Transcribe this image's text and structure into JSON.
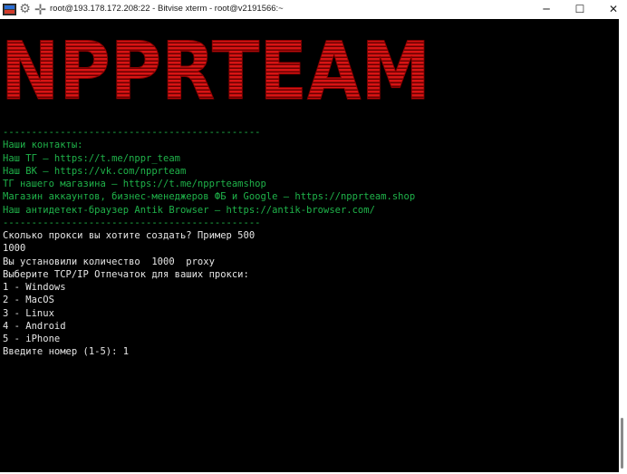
{
  "window": {
    "title": "root@193.178.172.208:22 - Bitvise xterm - root@v2191566:~",
    "app_icon": "terminal-app-icon",
    "gear_icon": "gear-icon",
    "new_icon": "plus-icon",
    "minimize": "─",
    "maximize": "☐",
    "close": "✕"
  },
  "banner": {
    "text": "NPPRTEAM",
    "color": "#d01010"
  },
  "terminal": {
    "lines": [
      {
        "text": "---------------------------------------------",
        "color": "green"
      },
      {
        "text": "Наши контакты:",
        "color": "green"
      },
      {
        "text": "Наш ТГ — https://t.me/nppr_team",
        "color": "green"
      },
      {
        "text": "Наш ВК — https://vk.com/npprteam",
        "color": "green"
      },
      {
        "text": "ТГ нашего магазина — https://t.me/npprteamshop",
        "color": "green"
      },
      {
        "text": "Магазин аккаунтов, бизнес-менеджеров ФБ и Google — https://npprteam.shop",
        "color": "green"
      },
      {
        "text": "Наш антидетект-браузер Antik Browser — https://antik-browser.com/",
        "color": "green"
      },
      {
        "text": "---------------------------------------------",
        "color": "green"
      },
      {
        "text": "Сколько прокси вы хотите создать? Пример 500",
        "color": "white"
      },
      {
        "text": "1000",
        "color": "white"
      },
      {
        "text": "Вы установили количество  1000  proxy",
        "color": "white"
      },
      {
        "text": "Выберите TCP/IP Отпечаток для ваших прокси:",
        "color": "white"
      },
      {
        "text": "1 - Windows",
        "color": "white"
      },
      {
        "text": "2 - MacOS",
        "color": "white"
      },
      {
        "text": "3 - Linux",
        "color": "white"
      },
      {
        "text": "4 - Android",
        "color": "white"
      },
      {
        "text": "5 - iPhone",
        "color": "white"
      },
      {
        "text": "Введите номер (1-5): 1",
        "color": "white"
      }
    ]
  }
}
